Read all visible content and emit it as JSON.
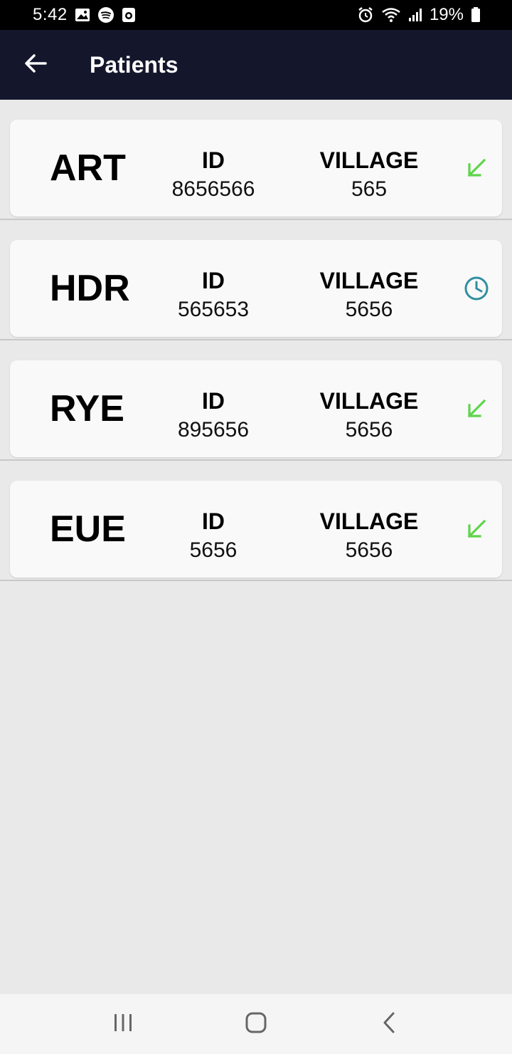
{
  "status_bar": {
    "time": "5:42",
    "battery_percent": "19%",
    "left_icons": [
      "gallery-icon",
      "spotify-icon",
      "camera-icon"
    ],
    "right_icons": [
      "alarm-icon",
      "wifi-icon",
      "signal-icon",
      "battery-icon"
    ]
  },
  "app_bar": {
    "title": "Patients",
    "back_icon": "arrow-left-icon",
    "background": "#14162c"
  },
  "patients": [
    {
      "code": "ART",
      "id_label": "ID",
      "id": "8656566",
      "village_label": "VILLAGE",
      "village": "565",
      "status_icon": "arrow-down-left-icon"
    },
    {
      "code": "HDR",
      "id_label": "ID",
      "id": "565653",
      "village_label": "VILLAGE",
      "village": "5656",
      "status_icon": "clock-icon"
    },
    {
      "code": "RYE",
      "id_label": "ID",
      "id": "895656",
      "village_label": "VILLAGE",
      "village": "5656",
      "status_icon": "arrow-down-left-icon"
    },
    {
      "code": "EUE",
      "id_label": "ID",
      "id": "5656",
      "village_label": "VILLAGE",
      "village": "5656",
      "status_icon": "arrow-down-left-icon"
    }
  ],
  "colors": {
    "synced_green": "#5fd44a",
    "pending_teal": "#2f8fa0"
  },
  "nav_bar": {
    "buttons": [
      "recent-apps-icon",
      "home-icon",
      "back-icon"
    ]
  }
}
